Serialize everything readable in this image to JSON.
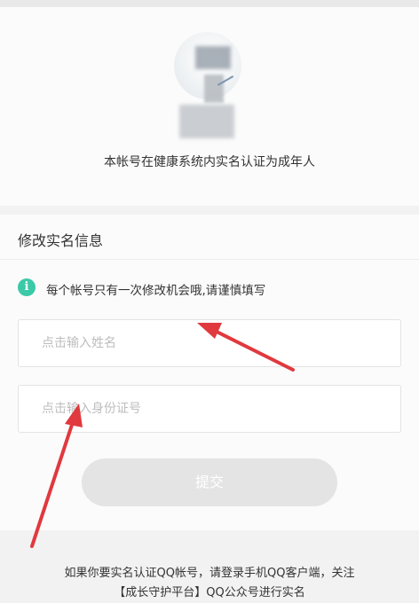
{
  "profile": {
    "avatar_icon": "user-avatar-icon",
    "verification_text": "本帐号在健康系统内实名认证为成年人"
  },
  "form": {
    "section_title": "修改实名信息",
    "notice": {
      "icon": "info-icon",
      "icon_glyph": "i",
      "icon_color": "#3cc9a8",
      "text": "每个帐号只有一次修改机会哦,请谨慎填写"
    },
    "name_input": {
      "placeholder": "点击输入姓名",
      "value": ""
    },
    "id_input": {
      "placeholder": "点击输入身份证号",
      "value": ""
    },
    "submit_label": "提交"
  },
  "footer": {
    "line1": "如果你要实名认证QQ帐号，请登录手机QQ客户端，关注",
    "line2": "【成长守护平台】QQ公众号进行实名"
  },
  "annotation": {
    "arrow_color": "#e0393e"
  }
}
